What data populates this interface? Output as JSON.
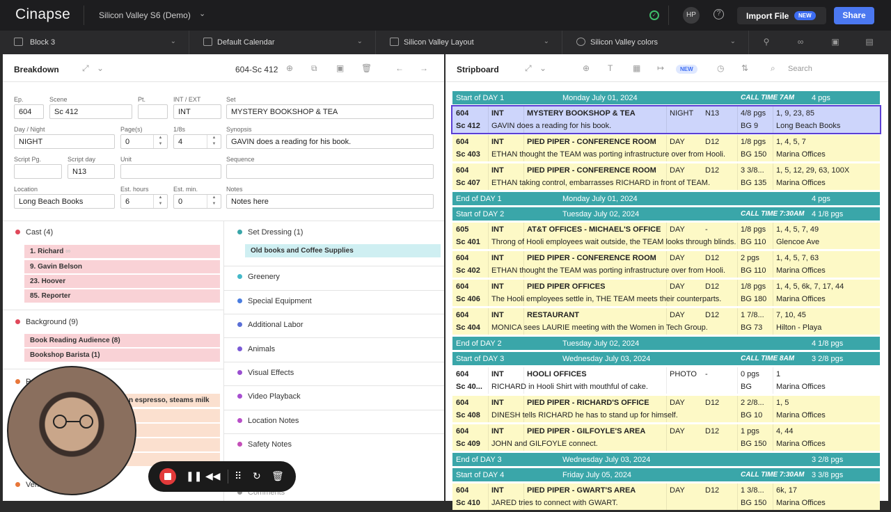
{
  "app": {
    "logo": "Cinapse",
    "project": "Silicon Valley S6 (Demo)",
    "avatar": "HP",
    "import_label": "Import File",
    "import_badge": "NEW",
    "share_label": "Share"
  },
  "toolbar": {
    "block": "Block 3",
    "calendar": "Default Calendar",
    "layout": "Silicon Valley Layout",
    "colors": "Silicon Valley colors"
  },
  "breakdown": {
    "title": "Breakdown",
    "scene_ref": "604-Sc 412",
    "labels": {
      "ep": "Ep.",
      "scene": "Scene",
      "pt": "Pt.",
      "intext": "INT / EXT",
      "set": "Set",
      "daynight": "Day / Night",
      "pages": "Page(s)",
      "eighths": "1/8s",
      "synopsis": "Synopsis",
      "scriptpg": "Script Pg.",
      "scriptday": "Script day",
      "unit": "Unit",
      "sequence": "Sequence",
      "location": "Location",
      "esthours": "Est. hours",
      "estmin": "Est. min.",
      "notes": "Notes"
    },
    "values": {
      "ep": "604",
      "scene": "Sc 412",
      "pt": "",
      "intext": "INT",
      "set": "MYSTERY BOOKSHOP & TEA",
      "daynight": "NIGHT",
      "pages": "0",
      "eighths": "4",
      "synopsis": "GAVIN does a reading for his book.",
      "scriptpg": "",
      "scriptday": "N13",
      "unit": "",
      "sequence": "",
      "location": "Long Beach Books",
      "esthours": "6",
      "estmin": "0",
      "notes": "Notes here"
    },
    "cast_title": "Cast (4)",
    "cast": [
      "1. Richard",
      "9. Gavin Belson",
      "23. Hoover",
      "85. Reporter"
    ],
    "background_title": "Background (9)",
    "background": [
      "Book Reading Audience (8)",
      "Bookshop Barista (1)"
    ],
    "props_title": "Pr",
    "props_first": "n espresso, steams milk",
    "vehicles_title": "Veh",
    "right_cats": [
      {
        "name": "Set Dressing (1)",
        "color": "#3aa6a9"
      },
      {
        "name": "Greenery",
        "color": "#44b8c8"
      },
      {
        "name": "Special Equipment",
        "color": "#4a7de0"
      },
      {
        "name": "Additional Labor",
        "color": "#5a6fd6"
      },
      {
        "name": "Animals",
        "color": "#7a5ad6"
      },
      {
        "name": "Visual Effects",
        "color": "#9a4fd0"
      },
      {
        "name": "Video Playback",
        "color": "#a74fd0"
      },
      {
        "name": "Location Notes",
        "color": "#b84fc8"
      },
      {
        "name": "Safety Notes",
        "color": "#c44fb8"
      },
      {
        "name": "Comments",
        "color": "#999999"
      }
    ],
    "set_dressing_item": "Old books and Coffee Supplies"
  },
  "stripboard": {
    "title": "Stripboard",
    "new_badge": "NEW",
    "search_placeholder": "Search",
    "rows": [
      {
        "kind": "day",
        "a": "Start of DAY 1",
        "b": "Monday July 01, 2024",
        "c": "CALL TIME 7AM",
        "d": "4 pgs"
      },
      {
        "kind": "strip",
        "style": "sel",
        "ep": "604",
        "ie": "INT",
        "set": "MYSTERY BOOKSHOP & TEA",
        "dn": "NIGHT",
        "sd": "N13",
        "pg": "4/8 pgs",
        "cast": "1, 9, 23, 85",
        "sc": "Sc 412",
        "syn": "GAVIN does a reading for his book.",
        "bg": "BG 9",
        "loc": "Long Beach Books"
      },
      {
        "kind": "strip",
        "style": "",
        "ep": "604",
        "ie": "INT",
        "set": "PIED PIPER - CONFERENCE ROOM",
        "dn": "DAY",
        "sd": "D12",
        "pg": "1/8 pgs",
        "cast": "1, 4, 5, 7",
        "sc": "Sc 403",
        "syn": "ETHAN thought the TEAM was porting infrastructure over from Hooli.",
        "bg": "BG 150",
        "loc": "Marina Offices"
      },
      {
        "kind": "strip",
        "style": "",
        "ep": "604",
        "ie": "INT",
        "set": "PIED PIPER - CONFERENCE ROOM",
        "dn": "DAY",
        "sd": "D12",
        "pg": "3 3/8...",
        "cast": "1, 5, 12, 29, 63, 100X",
        "sc": "Sc 407",
        "syn": "ETHAN taking control, embarrasses RICHARD in front of TEAM.",
        "bg": "BG 135",
        "loc": "Marina Offices"
      },
      {
        "kind": "day",
        "a": "End of DAY 1",
        "b": "Monday July 01, 2024",
        "c": "",
        "d": "4 pgs"
      },
      {
        "kind": "day",
        "a": "Start of DAY 2",
        "b": "Tuesday July 02, 2024",
        "c": "CALL TIME 7:30AM",
        "d": "4 1/8 pgs"
      },
      {
        "kind": "strip",
        "style": "",
        "ep": "605",
        "ie": "INT",
        "set": "AT&T OFFICES - MICHAEL'S OFFICE",
        "dn": "DAY",
        "sd": "-",
        "pg": "1/8 pgs",
        "cast": "1, 4, 5, 7, 49",
        "sc": "Sc 401",
        "syn": "Throng of Hooli employees wait outside, the TEAM looks through blinds.",
        "bg": "BG 110",
        "loc": "Glencoe Ave"
      },
      {
        "kind": "strip",
        "style": "",
        "ep": "604",
        "ie": "INT",
        "set": "PIED PIPER - CONFERENCE ROOM",
        "dn": "DAY",
        "sd": "D12",
        "pg": "2 pgs",
        "cast": "1, 4, 5, 7, 63",
        "sc": "Sc 402",
        "syn": "ETHAN thought the TEAM was porting infrastructure over from Hooli.",
        "bg": "BG 110",
        "loc": "Marina Offices"
      },
      {
        "kind": "strip",
        "style": "",
        "ep": "604",
        "ie": "INT",
        "set": "PIED PIPER OFFICES",
        "dn": "DAY",
        "sd": "D12",
        "pg": "1/8 pgs",
        "cast": "1, 4, 5, 6k, 7, 17, 44",
        "sc": "Sc 406",
        "syn": "The Hooli employees settle in, THE TEAM meets their counterparts.",
        "bg": "BG 180",
        "loc": "Marina Offices"
      },
      {
        "kind": "strip",
        "style": "",
        "ep": "604",
        "ie": "INT",
        "set": "RESTAURANT",
        "dn": "DAY",
        "sd": "D12",
        "pg": "1 7/8...",
        "cast": "7, 10, 45",
        "sc": "Sc 404",
        "syn": "MONICA sees LAURIE meeting with the Women in Tech Group.",
        "bg": "BG 73",
        "loc": "Hilton - Playa"
      },
      {
        "kind": "day",
        "a": "End of DAY 2",
        "b": "Tuesday July 02, 2024",
        "c": "",
        "d": "4 1/8 pgs"
      },
      {
        "kind": "day",
        "a": "Start of DAY 3",
        "b": "Wednesday July 03, 2024",
        "c": "CALL TIME 8AM",
        "d": "3 2/8 pgs"
      },
      {
        "kind": "strip",
        "style": "white",
        "ep": "604",
        "ie": "INT",
        "set": "HOOLI OFFICES",
        "dn": "PHOTO",
        "sd": "-",
        "pg": "0 pgs",
        "cast": "1",
        "sc": "Sc 40...",
        "syn": "RICHARD in Hooli Shirt with mouthful of cake.",
        "bg": "BG",
        "loc": "Marina Offices"
      },
      {
        "kind": "strip",
        "style": "",
        "ep": "604",
        "ie": "INT",
        "set": "PIED PIPER - RICHARD'S OFFICE",
        "dn": "DAY",
        "sd": "D12",
        "pg": "2 2/8...",
        "cast": "1, 5",
        "sc": "Sc 408",
        "syn": "DINESH tells RICHARD he has to stand up for himself.",
        "bg": "BG 10",
        "loc": "Marina Offices"
      },
      {
        "kind": "strip",
        "style": "",
        "ep": "604",
        "ie": "INT",
        "set": "PIED PIPER - GILFOYLE'S AREA",
        "dn": "DAY",
        "sd": "D12",
        "pg": "1 pgs",
        "cast": "4, 44",
        "sc": "Sc 409",
        "syn": "JOHN and GILFOYLE connect.",
        "bg": "BG 150",
        "loc": "Marina Offices"
      },
      {
        "kind": "day",
        "a": "End of DAY 3",
        "b": "Wednesday July 03, 2024",
        "c": "",
        "d": "3 2/8 pgs"
      },
      {
        "kind": "day",
        "a": "Start of DAY 4",
        "b": "Friday July 05, 2024",
        "c": "CALL TIME 7:30AM",
        "d": "3 3/8 pgs"
      },
      {
        "kind": "strip",
        "style": "",
        "ep": "604",
        "ie": "INT",
        "set": "PIED PIPER - GWART'S AREA",
        "dn": "DAY",
        "sd": "D12",
        "pg": "1 3/8...",
        "cast": "6k, 17",
        "sc": "Sc 410",
        "syn": "JARED tries to connect with GWART.",
        "bg": "BG 150",
        "loc": "Marina Offices"
      }
    ]
  },
  "colors": {
    "day_bar": "#3aa6a9",
    "strip_yellow": "#fdf9c6",
    "selected": "#cdd5fb",
    "selected_border": "#5b3fd4",
    "cast_tag": "#f9d2d6",
    "props_tag": "#fbe0cf",
    "set_tag": "#cfeff2"
  }
}
